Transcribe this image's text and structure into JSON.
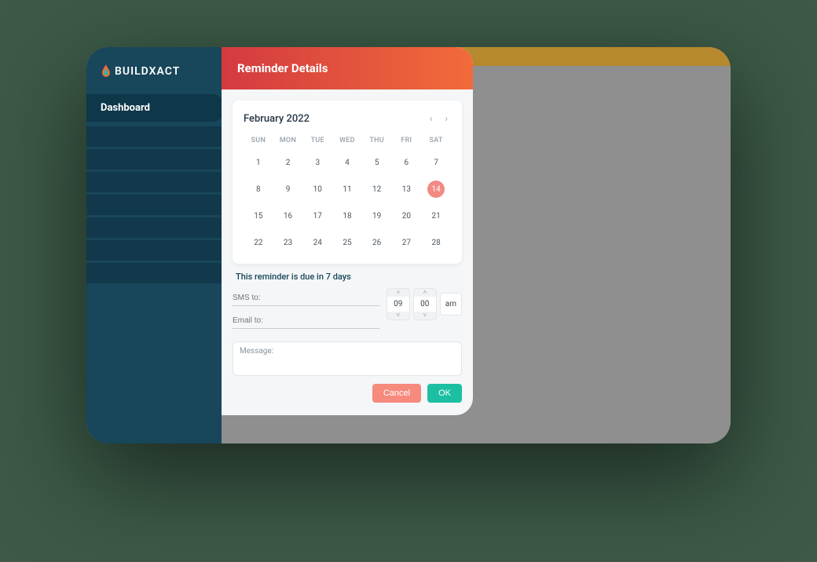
{
  "logo": {
    "brand": "BUILDXACT"
  },
  "sidebar": {
    "active_label": "Dashboard"
  },
  "modal": {
    "title": "Reminder Details",
    "due_note": "This reminder is due in 7 days",
    "sms_label": "SMS to:",
    "email_label": "Email to:",
    "message_label": "Message:",
    "cancel_label": "Cancel",
    "ok_label": "OK"
  },
  "calendar": {
    "month_label": "February 2022",
    "weekdays": [
      "SUN",
      "MON",
      "TUE",
      "WED",
      "THU",
      "FRI",
      "SAT"
    ],
    "weeks": [
      [
        1,
        2,
        3,
        4,
        5,
        6,
        7
      ],
      [
        8,
        9,
        10,
        11,
        12,
        13,
        14
      ],
      [
        15,
        16,
        17,
        18,
        19,
        20,
        21
      ],
      [
        22,
        23,
        24,
        25,
        26,
        27,
        28
      ]
    ],
    "selected_day": 14
  },
  "time": {
    "hour": "09",
    "minute": "00",
    "ampm": "am"
  }
}
